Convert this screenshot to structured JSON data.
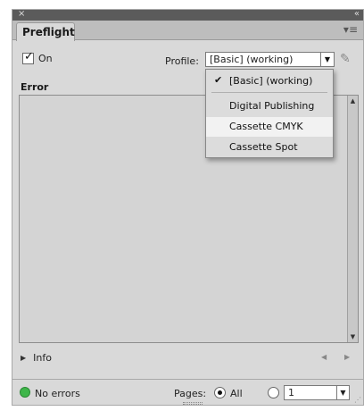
{
  "panel": {
    "tab_title": "Preflight",
    "close_glyph": "×",
    "collapse_glyph": "«",
    "menu_glyph": "▾≡"
  },
  "toolbar": {
    "on_label": "On",
    "on_checked": true,
    "profile_label": "Profile:",
    "profile_value": "[Basic] (working)",
    "edit_glyph": "✎"
  },
  "list": {
    "header": "Error",
    "up_glyph": "▲",
    "down_glyph": "▼"
  },
  "info": {
    "label": "Info",
    "expand_glyph": "▶",
    "prev_glyph": "◀",
    "next_glyph": "▶"
  },
  "status": {
    "text": "No errors",
    "color": "#3fb64a",
    "pages_label": "Pages:",
    "all_label": "All",
    "range_value": "1",
    "arrow_glyph": "▼",
    "resize_glyph": "⋰"
  },
  "dropdown": {
    "items": [
      {
        "label": "[Basic] (working)",
        "checked": true
      },
      {
        "label": "Digital Publishing",
        "checked": false
      },
      {
        "label": "Cassette CMYK",
        "checked": false
      },
      {
        "label": "Cassette Spot",
        "checked": false
      }
    ]
  }
}
